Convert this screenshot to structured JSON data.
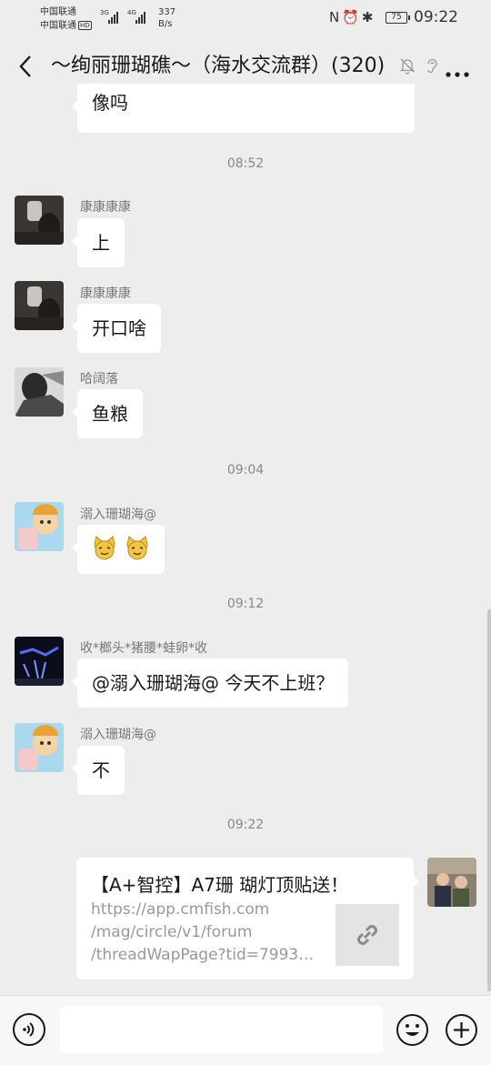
{
  "status_bar": {
    "carrier_1": "中国联通",
    "carrier_2": "中国联通",
    "hd_badge": "HD",
    "sig_1": "3G",
    "sig_2": "4G",
    "net_speed_value": "337",
    "net_speed_unit": "B/s",
    "battery": "75",
    "time": "09:22",
    "icons": [
      "nfc-icon",
      "alarm-icon",
      "bluetooth-icon"
    ]
  },
  "header": {
    "title": "～绚丽珊瑚礁～（海水交流群）(320)",
    "icons": [
      "back-icon",
      "mute-icon",
      "ear-icon",
      "more-icon"
    ]
  },
  "messages": [
    {
      "type": "text",
      "direction": "in",
      "text": "像吗"
    },
    {
      "type": "time",
      "text": "08:52"
    },
    {
      "type": "text",
      "direction": "in",
      "sender": "康康康康",
      "text": "上"
    },
    {
      "type": "text",
      "direction": "in",
      "sender": "康康康康",
      "text": "开口啥"
    },
    {
      "type": "text",
      "direction": "in",
      "sender": "哈阔落",
      "text": "鱼粮"
    },
    {
      "type": "time",
      "text": "09:04"
    },
    {
      "type": "emoji",
      "direction": "in",
      "sender": "溺入珊瑚海@",
      "emoji": [
        "cat-face-emoji",
        "cat-face-emoji"
      ]
    },
    {
      "type": "time",
      "text": "09:12"
    },
    {
      "type": "text",
      "direction": "in",
      "sender": "收*榔头*猪腰*蛙卵*收",
      "text": "@溺入珊瑚海@ 今天不上班？"
    },
    {
      "type": "text",
      "direction": "in",
      "sender": "溺入珊瑚海@",
      "text": "不"
    },
    {
      "type": "time",
      "text": "09:22"
    },
    {
      "type": "link_card",
      "direction": "out",
      "title": "【A+智控】A7珊 瑚灯顶贴送！",
      "url_lines": [
        "https://app.cmfish.com",
        "/mag/circle/v1/forum",
        "/threadWapPage?tid=79930..."
      ],
      "thumb_icon": "link-icon"
    }
  ],
  "input_bar": {
    "placeholder": "",
    "icons": [
      "voice-icon",
      "emoji-icon",
      "plus-icon"
    ]
  },
  "colors": {
    "background": "#ededed",
    "bubble": "#ffffff",
    "text": "#191919",
    "meta_text": "#888888"
  }
}
